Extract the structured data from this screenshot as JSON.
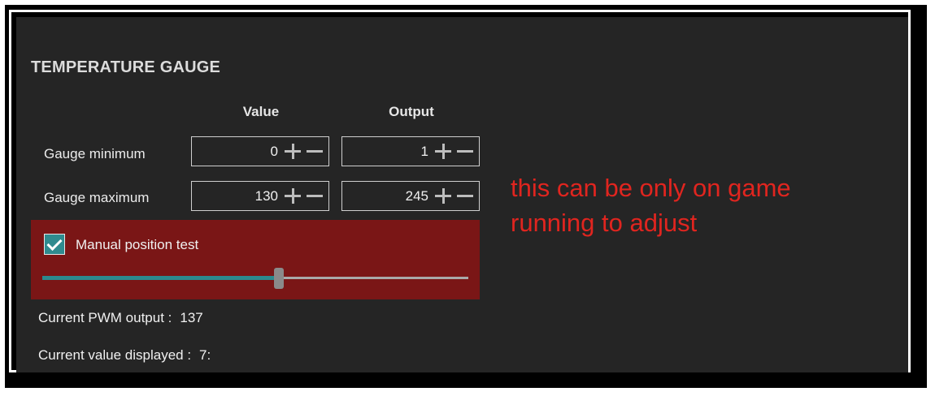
{
  "section_title": "TEMPERATURE GAUGE",
  "columns": {
    "value": "Value",
    "output": "Output"
  },
  "rows": [
    {
      "label": "Gauge minimum",
      "value": "0",
      "output": "1"
    },
    {
      "label": "Gauge maximum",
      "value": "130",
      "output": "245"
    }
  ],
  "manual_test": {
    "label": "Manual position test",
    "checked": true,
    "slider_fraction": 0.555
  },
  "info": {
    "pwm_label": "Current PWM output :",
    "pwm_value": "137",
    "displayed_label": "Current value displayed :",
    "displayed_value": "7:"
  },
  "note": "this can be only on game running to adjust",
  "colors": {
    "panel_bg": "#252525",
    "manual_bg": "#7a1616",
    "accent": "#2c8a8e",
    "note": "#e0251f"
  },
  "icons": {
    "increment": "plus-icon",
    "decrement": "minus-icon",
    "check": "check-icon"
  }
}
